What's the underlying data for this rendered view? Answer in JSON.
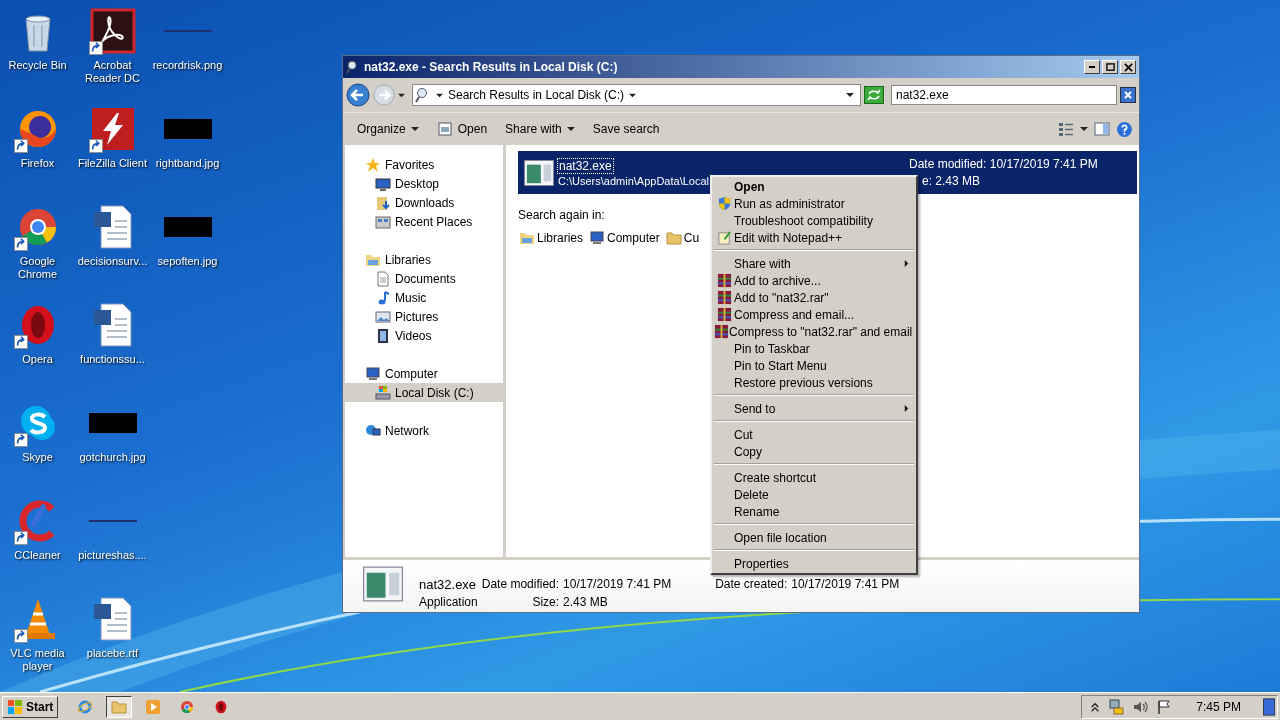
{
  "desktop": {
    "icons": [
      {
        "label": "Recycle Bin",
        "kind": "recycle",
        "shortcut": false
      },
      {
        "label": "Firefox",
        "kind": "firefox",
        "shortcut": true
      },
      {
        "label": "Google Chrome",
        "kind": "chrome",
        "shortcut": true
      },
      {
        "label": "Opera",
        "kind": "opera",
        "shortcut": true
      },
      {
        "label": "Skype",
        "kind": "skype",
        "shortcut": true
      },
      {
        "label": "CCleaner",
        "kind": "ccleaner",
        "shortcut": true
      },
      {
        "label": "VLC media player",
        "kind": "vlc",
        "shortcut": true
      },
      {
        "label": "Acrobat Reader DC",
        "kind": "acrobat",
        "shortcut": true
      },
      {
        "label": "FileZilla Client",
        "kind": "filezilla",
        "shortcut": true
      },
      {
        "label": "decisionsurv...",
        "kind": "word",
        "shortcut": false
      },
      {
        "label": "functionssu...",
        "kind": "word",
        "shortcut": false
      },
      {
        "label": "gotchurch.jpg",
        "kind": "dark-image",
        "shortcut": false
      },
      {
        "label": "pictureshas....",
        "kind": "blank-image",
        "shortcut": false
      },
      {
        "label": "placebe.rtf",
        "kind": "word",
        "shortcut": false
      },
      {
        "label": "recordrisk.png",
        "kind": "blank-image",
        "shortcut": false
      },
      {
        "label": "rightband.jpg",
        "kind": "dark-image",
        "shortcut": false
      },
      {
        "label": "sepoften.jpg",
        "kind": "dark-image",
        "shortcut": false
      }
    ]
  },
  "window": {
    "title": "nat32.exe - Search Results in Local Disk (C:)",
    "address": "Search Results in Local Disk (C:)",
    "search": {
      "value": "nat32.exe"
    },
    "toolbar": [
      {
        "label": "Organize",
        "kind": "menu"
      },
      {
        "label": "Open",
        "kind": "open"
      },
      {
        "label": "Share with",
        "kind": "menu"
      },
      {
        "label": "Save search",
        "kind": "plain"
      }
    ],
    "nav": [
      {
        "label": "Favorites",
        "selected": false,
        "children": [
          {
            "label": "Desktop",
            "selected": false
          },
          {
            "label": "Downloads",
            "selected": false
          },
          {
            "label": "Recent Places",
            "selected": false
          }
        ]
      },
      {
        "label": "Libraries",
        "selected": false,
        "children": [
          {
            "label": "Documents",
            "selected": false
          },
          {
            "label": "Music",
            "selected": false
          },
          {
            "label": "Pictures",
            "selected": false
          },
          {
            "label": "Videos",
            "selected": false
          }
        ]
      },
      {
        "label": "Computer",
        "selected": false,
        "children": [
          {
            "label": "Local Disk (C:)",
            "selected": true
          }
        ]
      },
      {
        "label": "Network",
        "selected": false
      }
    ],
    "results": [
      {
        "name": "nat32.exe",
        "path": "C:\\Users\\admin\\AppData\\Local",
        "date_modified": "Date modified: 10/17/2019 7:41 PM",
        "size": "e: 2.43 MB",
        "selected": true
      }
    ],
    "search_again": {
      "label": "Search again in:",
      "locations": [
        {
          "label": "Libraries"
        },
        {
          "label": "Computer"
        },
        {
          "label": "Cu"
        }
      ]
    },
    "details": {
      "name": "nat32.exe",
      "type": "Application",
      "fields": [
        {
          "label": "Date modified:",
          "value": "10/17/2019 7:41 PM"
        },
        {
          "label": "Size:",
          "value": "2.43 MB"
        },
        {
          "label": "Date created:",
          "value": "10/17/2019 7:41 PM"
        }
      ]
    }
  },
  "context_menu": {
    "groups": [
      [
        {
          "label": "Open",
          "default": true,
          "submenu": false
        },
        {
          "label": "Run as administrator",
          "kind": "shield",
          "default": false,
          "submenu": false
        },
        {
          "label": "Troubleshoot compatibility",
          "default": false,
          "submenu": false
        },
        {
          "label": "Edit with Notepad++",
          "kind": "notepad",
          "default": false,
          "submenu": false
        }
      ],
      [
        {
          "label": "Share with",
          "default": false,
          "submenu": true
        },
        {
          "label": "Add to archive...",
          "kind": "archive",
          "default": false,
          "submenu": false
        },
        {
          "label": "Add to \"nat32.rar\"",
          "kind": "archive",
          "default": false,
          "submenu": false
        },
        {
          "label": "Compress and email...",
          "kind": "archive",
          "default": false,
          "submenu": false
        },
        {
          "label": "Compress to \"nat32.rar\" and email",
          "kind": "archive",
          "default": false,
          "submenu": false
        },
        {
          "label": "Pin to Taskbar",
          "default": false,
          "submenu": false
        },
        {
          "label": "Pin to Start Menu",
          "default": false,
          "submenu": false
        },
        {
          "label": "Restore previous versions",
          "default": false,
          "submenu": false
        }
      ],
      [
        {
          "label": "Send to",
          "default": false,
          "submenu": true
        }
      ],
      [
        {
          "label": "Cut",
          "default": false,
          "submenu": false
        },
        {
          "label": "Copy",
          "default": false,
          "submenu": false
        }
      ],
      [
        {
          "label": "Create shortcut",
          "default": false,
          "submenu": false
        },
        {
          "label": "Delete",
          "default": false,
          "submenu": false
        },
        {
          "label": "Rename",
          "default": false,
          "submenu": false
        }
      ],
      [
        {
          "label": "Open file location",
          "default": false,
          "submenu": false
        }
      ],
      [
        {
          "label": "Properties",
          "default": false,
          "submenu": false
        }
      ]
    ]
  },
  "taskbar": {
    "start": "Start",
    "apps": [
      {
        "kind": "ie",
        "selected": false
      },
      {
        "kind": "explorer",
        "selected": true
      },
      {
        "kind": "media",
        "selected": false
      },
      {
        "kind": "chrome",
        "selected": false
      },
      {
        "kind": "opera",
        "selected": false
      }
    ],
    "clock": "7:45 PM"
  }
}
